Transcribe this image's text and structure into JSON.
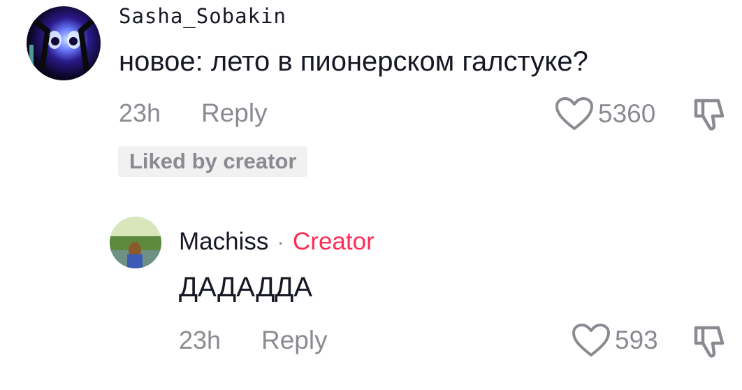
{
  "comment": {
    "username": "Sasha_Sobakin",
    "text": "новое: лето в пионерском галстуке?",
    "time": "23h",
    "reply_label": "Reply",
    "likes": "5360",
    "badge": "Liked by creator"
  },
  "reply": {
    "username": "Machiss",
    "separator": "·",
    "role_tag": "Creator",
    "text": "ДАДАДДА",
    "time": "23h",
    "reply_label": "Reply",
    "likes": "593"
  },
  "icons": {
    "like": "heart-outline-icon",
    "dislike": "thumbs-down-icon"
  },
  "colors": {
    "text_primary": "#161823",
    "text_secondary": "#8a8b91",
    "creator_accent": "#fe2c55",
    "badge_bg": "#f1f1f2"
  }
}
